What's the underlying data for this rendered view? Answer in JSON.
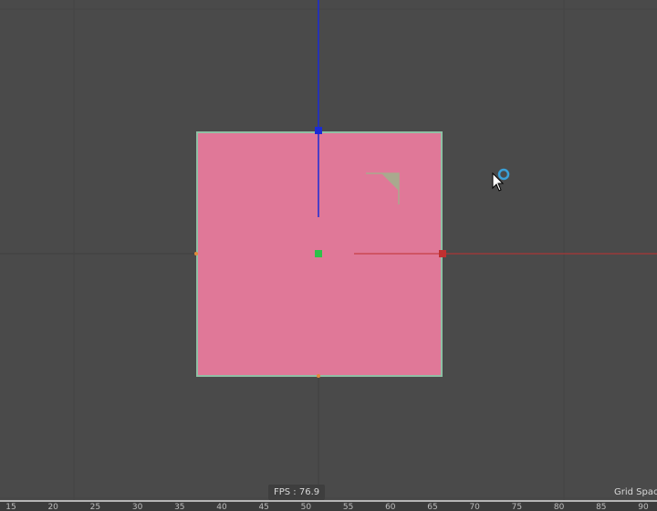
{
  "viewport": {
    "fps_label": "FPS : 76.9",
    "grid_spacing_label": "Grid Spac",
    "object_fill_color": "#e07898",
    "object_outline_color": "#8fbfa4",
    "axis_y_color": "#1a2bd6",
    "axis_x_color": "#c03030",
    "axis_center_color": "#2ec04a",
    "corner_widget_color": "#a9a98e",
    "cursor_icon": "mouse-pointer-icon",
    "busy_icon": "busy-ring-icon",
    "busy_color": "#3aa0d8"
  },
  "timeline": {
    "ticks": [
      "15",
      "20",
      "25",
      "30",
      "35",
      "40",
      "45",
      "50",
      "55",
      "60",
      "65",
      "70",
      "75",
      "80",
      "85",
      "90"
    ]
  }
}
